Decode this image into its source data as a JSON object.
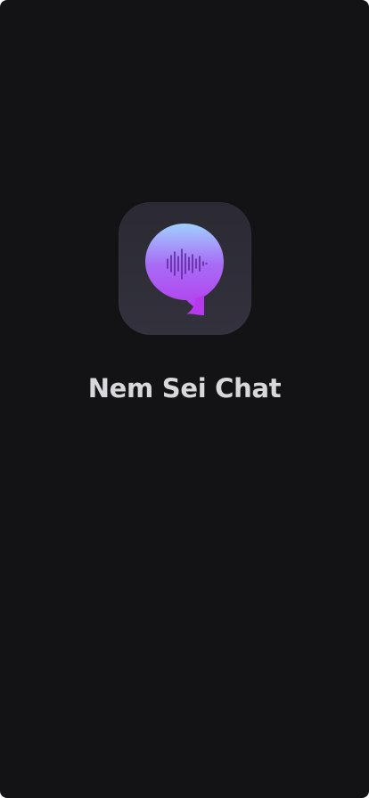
{
  "splash": {
    "app_name": "Nem Sei Chat",
    "icon": "chat-bubble-soundwave-icon"
  },
  "colors": {
    "background": "#131316",
    "icon_tile": "#2e2d36",
    "bubble_gradient_top": "#a8c4ff",
    "bubble_gradient_bottom": "#b33cf0",
    "wave": "#5a2a9a",
    "title": "#d8d8dc"
  }
}
